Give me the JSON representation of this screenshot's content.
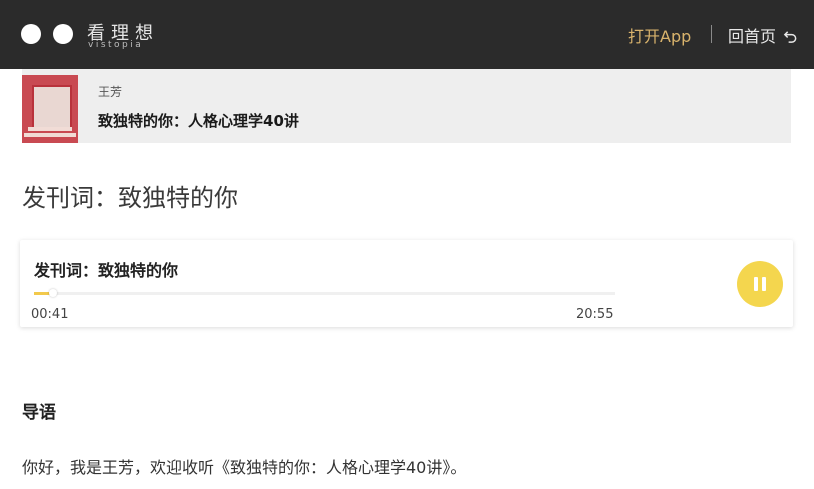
{
  "header": {
    "brand_cn": "看理想",
    "brand_en": "vistopia",
    "open_app": "打开App",
    "home": "回首页"
  },
  "course": {
    "author": "王芳",
    "title": "致独特的你：人格心理学40讲"
  },
  "article": {
    "title": "发刊词：致独特的你"
  },
  "player": {
    "title": "发刊词：致独特的你",
    "current_time": "00:41",
    "total_time": "20:55",
    "progress": 0.033,
    "state_icon": "pause-icon",
    "accent_color": "#f4d64e"
  },
  "content": {
    "heading": "导语",
    "paragraph": "你好，我是王芳，欢迎收听《致独特的你：人格心理学40讲》。"
  },
  "colors": {
    "topbar_bg": "#2b2b2b",
    "open_app": "#d9b36c",
    "card_bg": "#eeeeee"
  }
}
